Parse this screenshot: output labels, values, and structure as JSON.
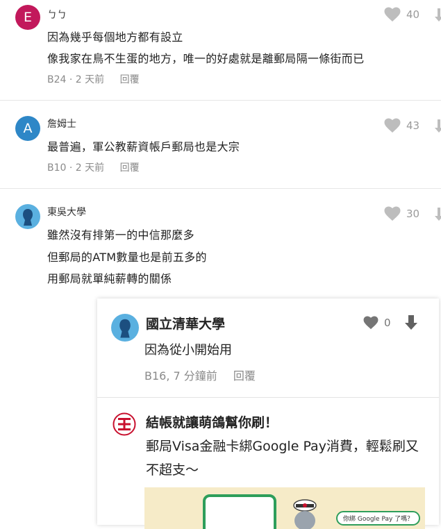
{
  "comments": [
    {
      "author": "ㄅㄅ",
      "avatar_letter": "E",
      "avatar_color": "#c2185b",
      "lines": [
        "因為幾乎每個地方都有設立",
        "像我家在鳥不生蛋的地方，唯一的好處就是離郵局隔一條街而已"
      ],
      "floor": "B24",
      "time": "2 天前",
      "reply_label": "回覆",
      "likes": "40"
    },
    {
      "author": "詹姆士",
      "avatar_letter": "A",
      "avatar_color": "#2e87c7",
      "lines": [
        "最普遍，軍公教薪資帳戶郵局也是大宗"
      ],
      "floor": "B10",
      "time": "2 天前",
      "reply_label": "回覆",
      "likes": "43"
    },
    {
      "author": "東吳大學",
      "avatar_color": "#5ab0e0",
      "lines": [
        "雖然沒有排第一的中信那麼多",
        "但郵局的ATM數量也是前五多的",
        "用郵局就單純薪轉的關係"
      ],
      "likes": "30"
    }
  ],
  "overlay_comment": {
    "author": "國立清華大學",
    "line": "因為從小開始用",
    "meta": "B16, 7 分鐘前",
    "reply_label": "回覆",
    "likes": "0"
  },
  "ad": {
    "title": "結帳就讓萌鴿幫你刷！",
    "body": "郵局Visa金融卡綁Google Pay消費，輕鬆刷又不超支～",
    "banner_text": "你綁 Google Pay 了嗎？",
    "logo_color": "#c8102e"
  },
  "colors": {
    "meta_gray": "#8a8a8a",
    "icon_gray": "#bdbdbd"
  }
}
